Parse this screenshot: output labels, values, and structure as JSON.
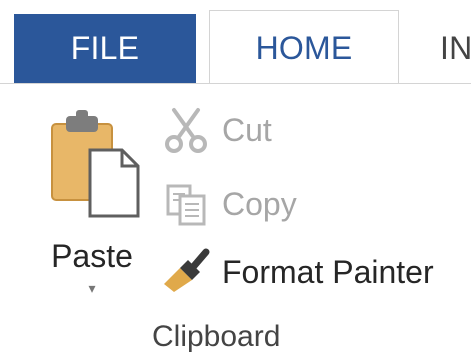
{
  "tabs": {
    "file": "FILE",
    "home": "HOME",
    "insert": "IN"
  },
  "clipboard": {
    "paste_label": "Paste",
    "paste_dropdown": "▾",
    "cut_label": "Cut",
    "copy_label": "Copy",
    "format_painter_label": "Format Painter",
    "group_label": "Clipboard"
  },
  "icons": {
    "paste": "clipboard-paste-icon",
    "cut": "scissors-icon",
    "copy": "copy-icon",
    "format_painter": "paintbrush-icon"
  },
  "colors": {
    "file_tab": "#2b579a",
    "home_tab_text": "#2b579a",
    "disabled_text": "#a6a6a6"
  }
}
